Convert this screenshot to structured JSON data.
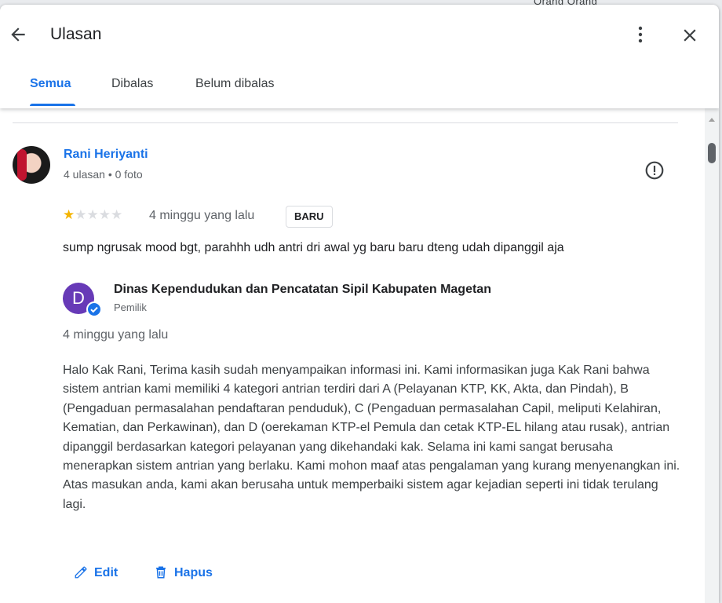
{
  "background": {
    "text": "Orang Orang"
  },
  "header": {
    "title": "Ulasan",
    "back_icon": "arrow-back-icon",
    "more_icon": "more-vert-icon",
    "close_icon": "close-icon"
  },
  "tabs": [
    {
      "label": "Semua",
      "active": true
    },
    {
      "label": "Dibalas",
      "active": false
    },
    {
      "label": "Belum dibalas",
      "active": false
    }
  ],
  "review": {
    "reviewer_name": "Rani Heriyanti",
    "reviewer_meta": "4 ulasan • 0 foto",
    "rating": 1,
    "rating_max": 5,
    "time": "4 minggu yang lalu",
    "badge": "BARU",
    "text": "sump ngrusak mood bgt, parahhh udh antri dri awal yg baru baru dteng udah dipanggil aja"
  },
  "reply": {
    "owner_initial": "D",
    "owner_name": "Dinas Kependudukan dan Pencatatan Sipil Kabupaten Magetan",
    "owner_role": "Pemilik",
    "time": "4 minggu yang lalu",
    "text": "Halo Kak Rani, Terima kasih sudah menyampaikan informasi ini. Kami informasikan juga Kak Rani bahwa sistem antrian kami memiliki 4 kategori antrian terdiri dari A (Pelayanan KTP, KK, Akta, dan Pindah), B (Pengaduan permasalahan pendaftaran penduduk), C (Pengaduan permasalahan Capil, meliputi Kelahiran, Kematian, dan Perkawinan), dan D (oerekaman KTP-el Pemula dan cetak KTP-EL hilang atau rusak), antrian dipanggil berdasarkan kategori pelayanan yang dikehandaki kak. Selama ini kami sangat berusaha menerapkan sistem antrian yang berlaku. Kami mohon maaf atas pengalaman yang kurang menyenangkan ini. Atas masukan anda, kami akan berusaha untuk memperbaiki sistem agar kejadian seperti ini tidak terulang lagi."
  },
  "actions": {
    "edit_label": "Edit",
    "delete_label": "Hapus"
  },
  "colors": {
    "accent": "#1a73e8",
    "star": "#f4b400",
    "owner_avatar": "#673ab7"
  }
}
